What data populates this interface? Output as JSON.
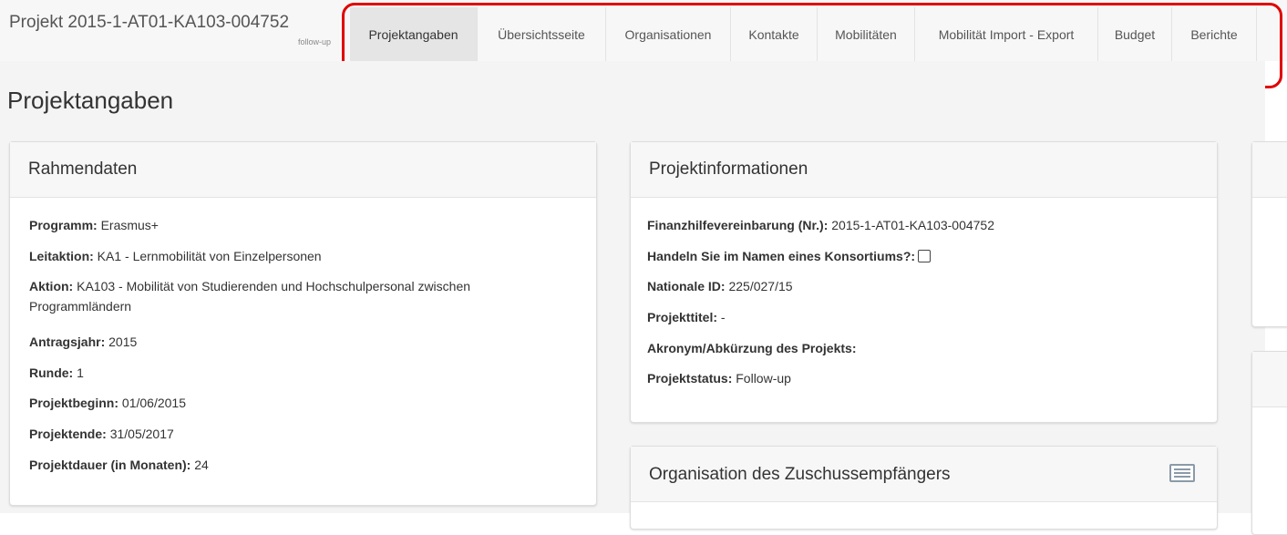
{
  "header": {
    "project_title": "Projekt 2015-1-AT01-KA103-004752",
    "project_subtitle": "follow-up"
  },
  "tabs": [
    {
      "label": "Projektangaben",
      "active": true
    },
    {
      "label": "Übersichtsseite",
      "active": false
    },
    {
      "label": "Organisationen",
      "active": false
    },
    {
      "label": "Kontakte",
      "active": false
    },
    {
      "label": "Mobilitäten",
      "active": false
    },
    {
      "label": "Mobilität Import - Export",
      "active": false
    },
    {
      "label": "Budget",
      "active": false
    },
    {
      "label": "Berichte",
      "active": false
    }
  ],
  "highlight_color": "#e00000",
  "page_title": "Projektangaben",
  "rahmendaten": {
    "title": "Rahmendaten",
    "fields": [
      {
        "label": "Programm:",
        "value": " Erasmus+"
      },
      {
        "label": "Leitaktion:",
        "value": " KA1 - Lernmobilität von Einzelpersonen"
      },
      {
        "label": "Aktion:",
        "value": " KA103 - Mobilität von Studierenden und Hochschulpersonal zwischen Programmländern"
      },
      {
        "label": "Antragsjahr:",
        "value": " 2015"
      },
      {
        "label": "Runde:",
        "value": " 1"
      },
      {
        "label": "Projektbeginn:",
        "value": " 01/06/2015"
      },
      {
        "label": "Projektende:",
        "value": " 31/05/2017"
      },
      {
        "label": "Projektdauer (in Monaten):",
        "value": " 24"
      }
    ]
  },
  "projektinformationen": {
    "title": "Projektinformationen",
    "fields": [
      {
        "label": "Finanzhilfevereinbarung (Nr.):",
        "value": " 2015-1-AT01-KA103-004752"
      },
      {
        "label": "Handeln Sie im Namen eines Konsortiums?:",
        "value": ""
      },
      {
        "label": "Nationale ID:",
        "value": " 225/027/15"
      },
      {
        "label": "Projekttitel:",
        "value": " -"
      },
      {
        "label": "Akronym/Abkürzung des Projekts:",
        "value": ""
      },
      {
        "label": "Projektstatus:",
        "value": " Follow-up"
      }
    ]
  },
  "organisation": {
    "title": "Organisation des Zuschussempfängers",
    "icon": "list-view-icon"
  }
}
